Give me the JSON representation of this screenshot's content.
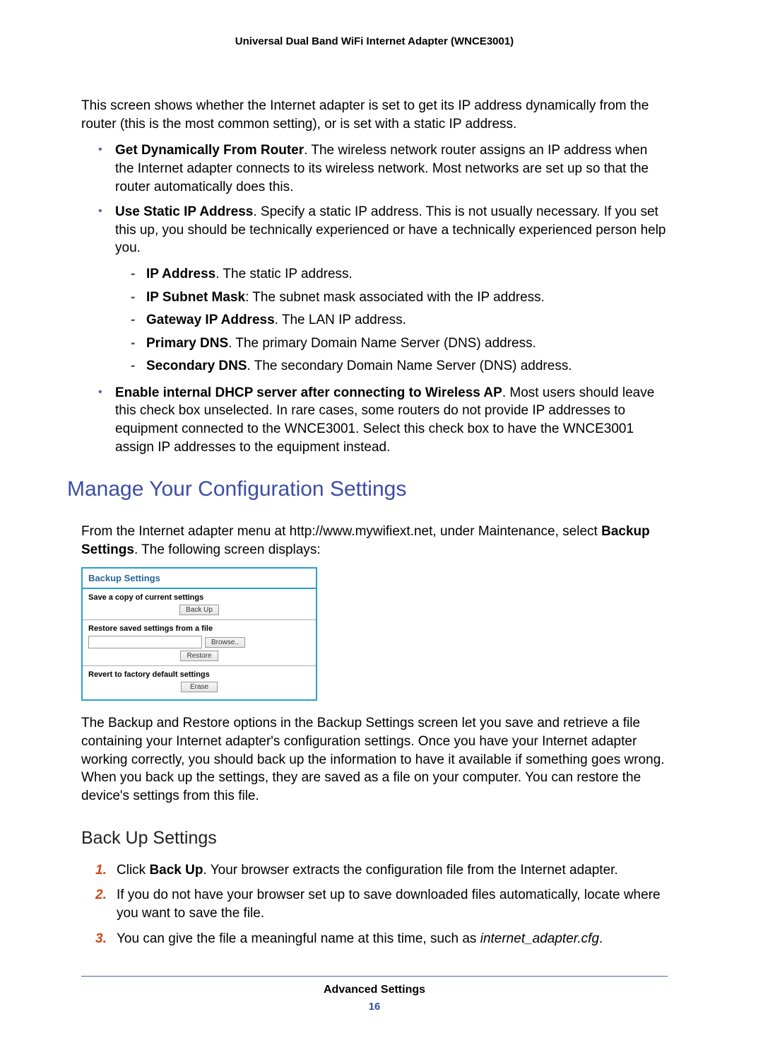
{
  "header": {
    "title": "Universal Dual Band WiFi Internet Adapter (WNCE3001)"
  },
  "intro": {
    "p1": "This screen shows whether the Internet adapter is set to get its IP address dynamically from the router (this is the most common setting), or is set with a static IP address."
  },
  "bullets": {
    "b1_bold": "Get Dynamically From Router",
    "b1_text": ". The wireless network router assigns an IP address when the Internet adapter connects to its wireless network. Most networks are set up so that the router automatically does this.",
    "b2_bold": "Use Static IP Address",
    "b2_text": ". Specify a static IP address. This is not usually necessary. If you set this up, you should be technically experienced or have a technically experienced person help you.",
    "b3_bold": "Enable internal DHCP server after connecting to Wireless AP",
    "b3_text": ". Most users should leave this check box unselected. In rare cases, some routers do not provide IP addresses to equipment connected to the WNCE3001. Select this check box to have the WNCE3001 assign IP addresses to the equipment instead."
  },
  "dashes": {
    "d1_b": "IP Address",
    "d1_t": ". The static IP address.",
    "d2_b": "IP Subnet Mask",
    "d2_t": ": The subnet mask associated with the IP address.",
    "d3_b": "Gateway IP Address",
    "d3_t": ". The LAN IP address.",
    "d4_b": "Primary DNS",
    "d4_t": ". The primary Domain Name Server (DNS) address.",
    "d5_b": "Secondary DNS",
    "d5_t": ". The secondary Domain Name Server (DNS) address."
  },
  "h2": "Manage Your Configuration Settings",
  "intro2": {
    "pre": "From the Internet adapter menu at http://www.mywifiext.net, under Maintenance, select ",
    "bold": "Backup Settings",
    "post": ". The following screen displays:"
  },
  "screenshot": {
    "title": "Backup Settings",
    "s1_label": "Save a copy of current settings",
    "s1_btn": "Back Up",
    "s2_label": "Restore saved settings from a file",
    "s2_browse": "Browse..",
    "s2_restore": "Restore",
    "s3_label": "Revert to factory default settings",
    "s3_btn": "Erase"
  },
  "para_after": "The Backup and Restore options in the Backup Settings screen let you save and retrieve a file containing your Internet adapter's configuration settings. Once you have your Internet adapter working correctly, you should back up the information to have it available if something goes wrong. When you back up the settings, they are saved as a file on your computer. You can restore the device's settings from this file.",
  "h3": "Back Up Settings",
  "steps": {
    "n1": "1.",
    "s1_pre": "Click ",
    "s1_bold": "Back Up",
    "s1_post": ". Your browser extracts the configuration file from the Internet adapter.",
    "n2": "2.",
    "s2": "If you do not have your browser set up to save downloaded files automatically, locate where you want to save the file.",
    "n3": "3.",
    "s3_pre": "You can give the file a meaningful name at this time, such as ",
    "s3_italic": "internet_adapter.cfg",
    "s3_post": "."
  },
  "footer": {
    "chapter": "Advanced Settings",
    "page": "16"
  }
}
